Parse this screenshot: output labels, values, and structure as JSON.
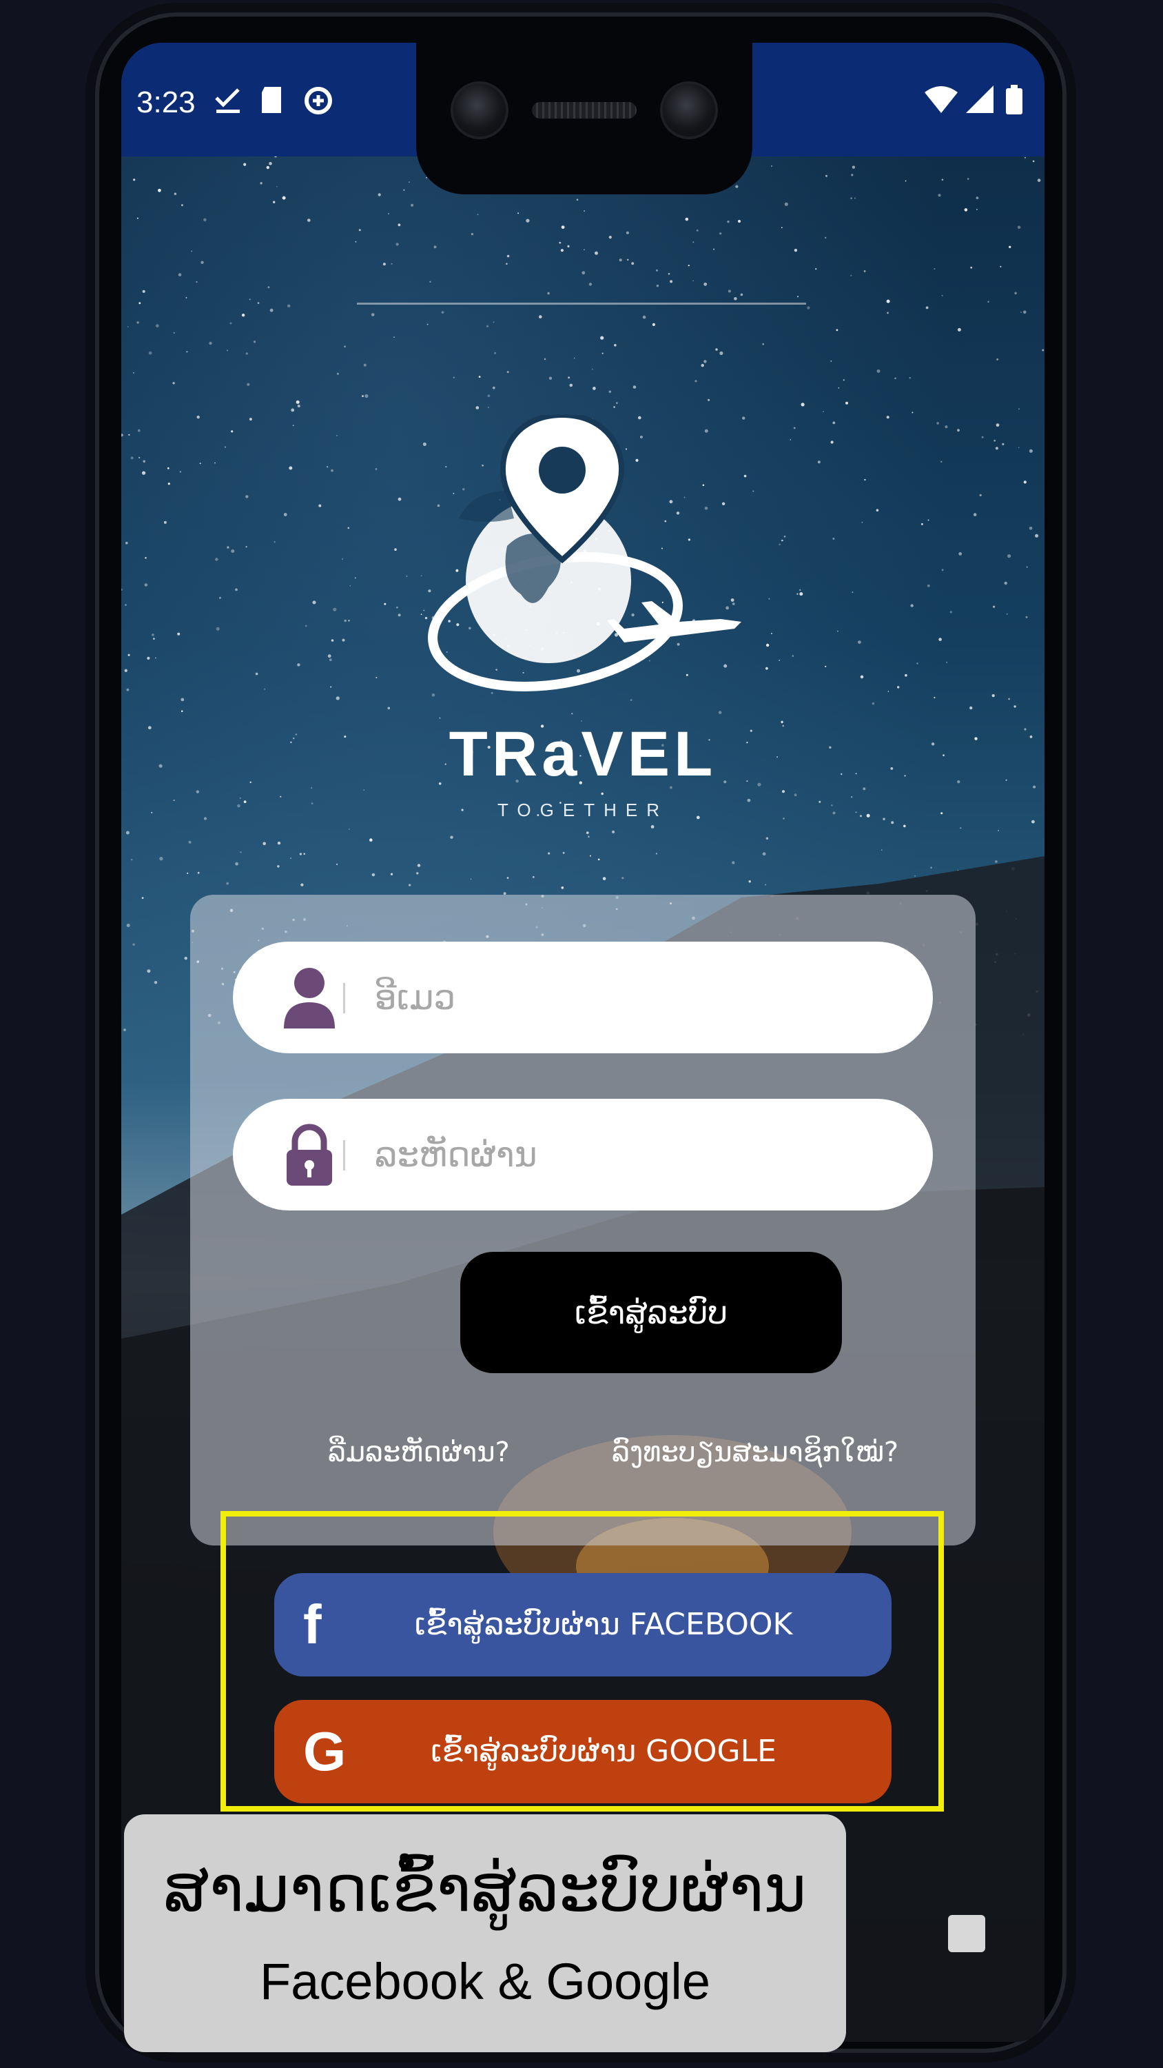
{
  "status_bar": {
    "time": "3:23",
    "icons_left": [
      "check-icon",
      "sd-card-icon",
      "data-saver-icon"
    ],
    "icons_right": [
      "wifi-icon",
      "signal-icon",
      "battery-icon"
    ]
  },
  "brand": {
    "name": "TRaVEL",
    "tagline": "TOGETHER"
  },
  "login_form": {
    "username_placeholder": "ອີເມວ",
    "password_placeholder": "ລະຫັດຜ່ານ",
    "login_label": "ເຂົ້າສູ່ລະບົບ",
    "forgot_password": "ລືມລະຫັດຜ່ານ?",
    "register": "ລົງທະບຽນສະມາຊິກໃໝ່?"
  },
  "social_login": {
    "facebook_label": "ເຂົ້າສູ່ລະບົບຜ່ານ FACEBOOK",
    "facebook_icon": "f",
    "google_label": "ເຂົ້າສູ່ລະບົບຜ່ານ GOOGLE",
    "google_icon": "G"
  },
  "caption": {
    "line1": "ສາມາດເຂົ້າສູ່ລະບົບຜ່ານ",
    "line2": "Facebook & Google"
  },
  "colors": {
    "status_bar": "#0b2c74",
    "facebook": "#3a559f",
    "google": "#c04110",
    "highlight": "#f2ee0c",
    "field_icon": "#6b4a78"
  }
}
